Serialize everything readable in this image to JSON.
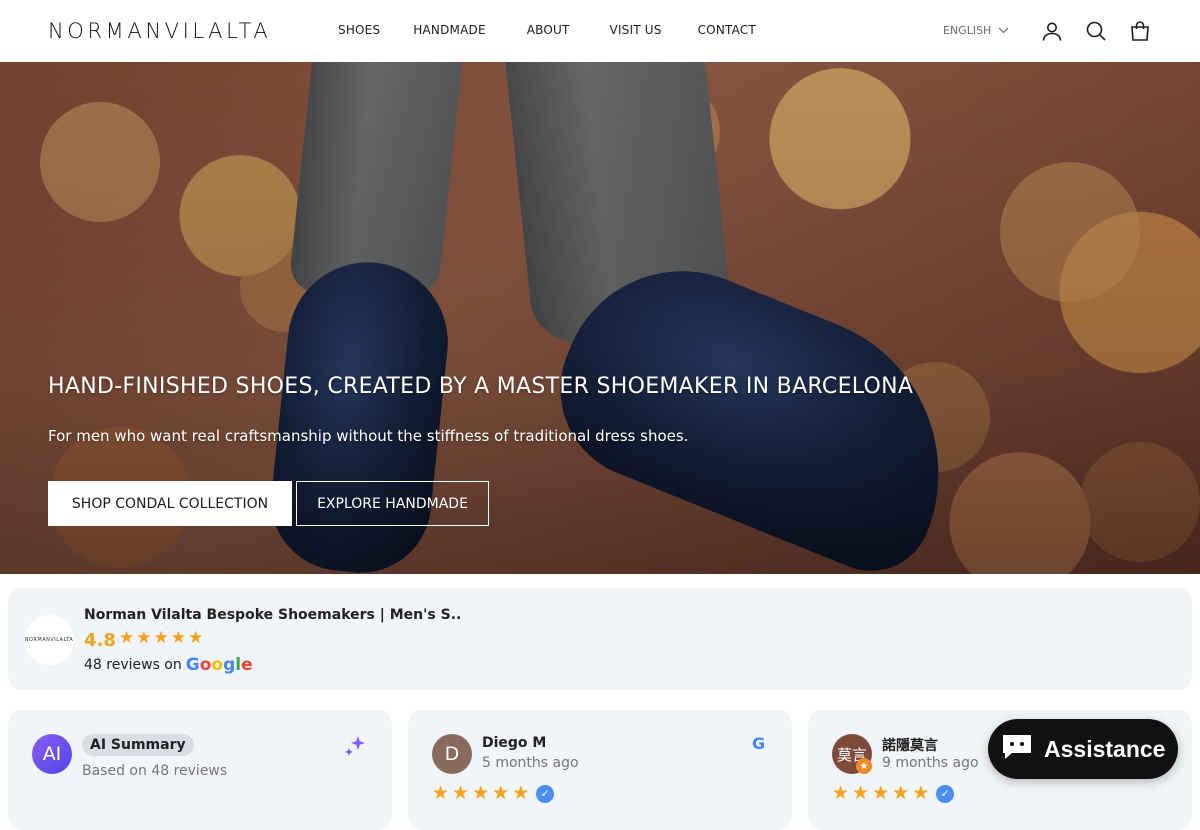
{
  "brand": {
    "logo_text": "NORMANVILALTA"
  },
  "nav": {
    "items": [
      "SHOES",
      "HANDMADE",
      "ABOUT",
      "VISIT US",
      "CONTACT"
    ]
  },
  "header": {
    "language": "ENGLISH",
    "icons": [
      "account-icon",
      "search-icon",
      "cart-icon"
    ]
  },
  "hero": {
    "title": "HAND-FINISHED SHOES, CREATED BY A MASTER SHOEMAKER IN BARCELONA",
    "subtitle": "For men who want real craftsmanship without the stiffness of traditional dress shoes.",
    "primary_button": "SHOP CONDAL COLLECTION",
    "secondary_button": "EXPLORE HANDMADE"
  },
  "reviews_badge": {
    "business_name": "Norman Vilalta Bespoke Shoemakers | Men's S..",
    "rating": "4.8",
    "stars": 5,
    "count_text": "48 reviews on",
    "platform": "Google",
    "star_color": "#f4a11c"
  },
  "review_cards": [
    {
      "type": "ai",
      "avatar_text": "AI",
      "title": "AI Summary",
      "subtitle": "Based on 48 reviews",
      "avatar_color": "#6d4ff2"
    },
    {
      "type": "review",
      "avatar_text": "D",
      "name": "Diego M",
      "time": "5 months ago",
      "stars": 5,
      "avatar_color": "#8a6a5c"
    },
    {
      "type": "review",
      "avatar_text": "莫言",
      "name": "諾隱莫言",
      "time": "9 months ago",
      "stars": 5,
      "avatar_color": "#7d4a3c"
    }
  ],
  "chat": {
    "label": "Assistance"
  }
}
